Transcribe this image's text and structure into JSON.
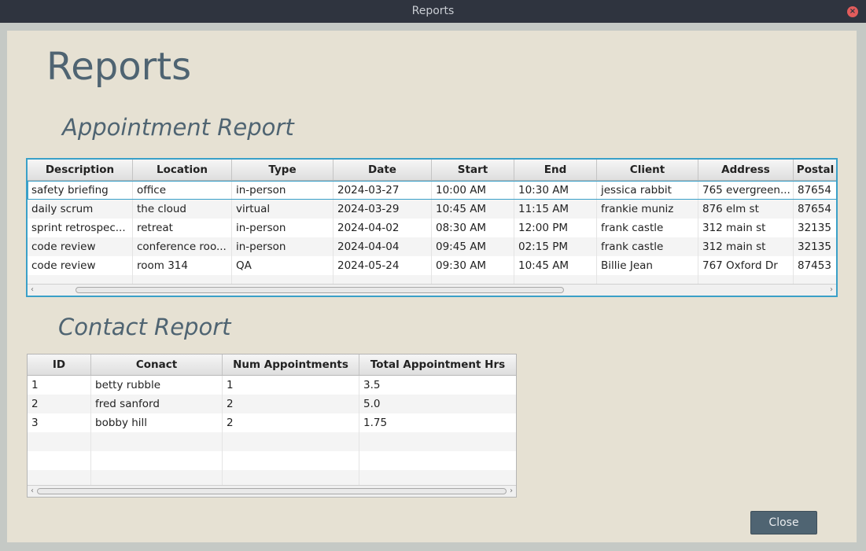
{
  "window": {
    "title": "Reports",
    "close_glyph": "×"
  },
  "page": {
    "title": "Reports"
  },
  "appointments": {
    "heading": "Appointment Report",
    "columns": [
      "Description",
      "Location",
      "Type",
      "Date",
      "Start",
      "End",
      "Client",
      "Address",
      "Postal"
    ],
    "rows": [
      [
        "safety briefing",
        "office",
        "in-person",
        "2024-03-27",
        "10:00 AM",
        "10:30 AM",
        "jessica rabbit",
        "765 evergreen...",
        "87654"
      ],
      [
        "daily scrum",
        "the cloud",
        "virtual",
        "2024-03-29",
        "10:45 AM",
        "11:15 AM",
        "frankie muniz",
        "876 elm st",
        "87654"
      ],
      [
        "sprint retrospec...",
        "retreat",
        "in-person",
        "2024-04-02",
        "08:30 AM",
        "12:00 PM",
        "frank castle",
        "312 main st",
        "32135"
      ],
      [
        "code review",
        "conference roo...",
        "in-person",
        "2024-04-04",
        "09:45 AM",
        "02:15 PM",
        "frank castle",
        "312 main st",
        "32135"
      ],
      [
        "code review",
        "room 314",
        "QA",
        "2024-05-24",
        "09:30 AM",
        "10:45 AM",
        "Billie Jean",
        "767 Oxford Dr",
        "87453"
      ]
    ]
  },
  "contacts": {
    "heading": "Contact Report",
    "columns": [
      "ID",
      "Conact",
      "Num Appointments",
      "Total Appointment Hrs"
    ],
    "rows": [
      [
        "1",
        "betty rubble",
        "1",
        "3.5"
      ],
      [
        "2",
        "fred sanford",
        "2",
        "5.0"
      ],
      [
        "3",
        "bobby hill",
        "2",
        "1.75"
      ]
    ]
  },
  "scroll_arrows": {
    "left": "‹",
    "right": "›"
  },
  "buttons": {
    "close": "Close"
  },
  "colors": {
    "accent": "#4f6472",
    "selection": "#3aa0c8",
    "panel": "#e6e1d3"
  }
}
